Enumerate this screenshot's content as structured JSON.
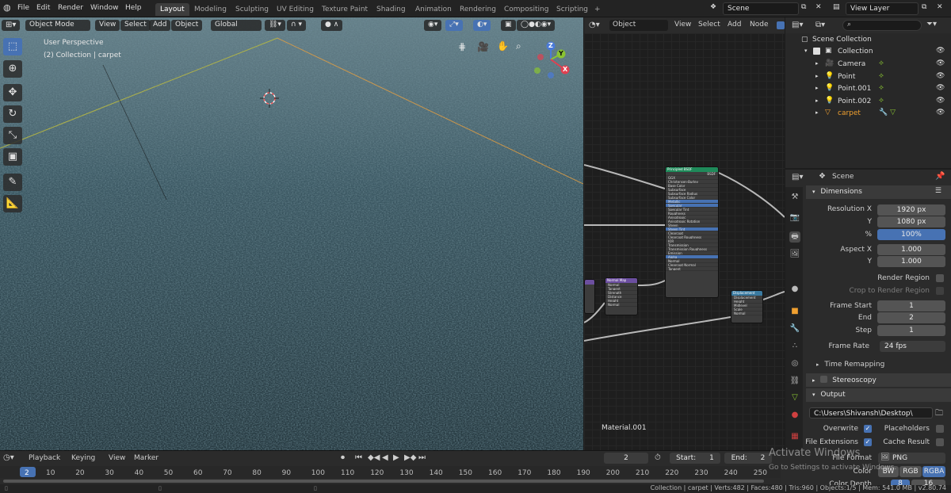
{
  "topbar": {
    "menus": [
      "File",
      "Edit",
      "Render",
      "Window",
      "Help"
    ],
    "workspaces": [
      "Layout",
      "Modeling",
      "Sculpting",
      "UV Editing",
      "Texture Paint",
      "Shading",
      "Animation",
      "Rendering",
      "Compositing",
      "Scripting"
    ],
    "add_workspace": "+",
    "scene_name": "Scene",
    "view_layer": "View Layer"
  },
  "viewport": {
    "mode": "Object Mode",
    "menus": [
      "View",
      "Select",
      "Add",
      "Object"
    ],
    "transform_orientation": "Global",
    "overlay_title": "User Perspective",
    "overlay_subtitle": "(2) Collection | carpet",
    "gizmo_axes": {
      "z": "Z",
      "y": "Y",
      "x": "X"
    }
  },
  "node_editor": {
    "header_object": "Object",
    "menus": [
      "View",
      "Select",
      "Add",
      "Node"
    ],
    "material_label": "Material.001",
    "bsdf_title": "Principled BSDF",
    "bsdf_output": "BSDF",
    "bsdf_inputs": [
      "GGX",
      "Christensen-Burley",
      "Base Color",
      "Subsurface",
      "Subsurface Radius",
      "Subsurface Color",
      "Metallic",
      "Specular",
      "Specular Tint",
      "Roughness",
      "Anisotropic",
      "Anisotropic Rotation",
      "Sheen",
      "Sheen Tint",
      "Clearcoat",
      "Clearcoat Roughness",
      "IOR",
      "Transmission",
      "Transmission Roughness",
      "Emission",
      "Alpha",
      "Normal",
      "Clearcoat Normal",
      "Tangent"
    ],
    "normal_title": "Normal Map",
    "normal_rows": [
      "Normal",
      "Tangent",
      "Strength",
      "Distance",
      "Height",
      "Normal"
    ],
    "disp_title": "Displacement",
    "disp_rows": [
      "Displacement",
      "Height",
      "Midlevel",
      "Scale",
      "Normal"
    ]
  },
  "outliner": {
    "root": "Scene Collection",
    "collection": "Collection",
    "items": [
      {
        "name": "Camera",
        "icon": "camera-icon"
      },
      {
        "name": "Point",
        "icon": "light-icon"
      },
      {
        "name": "Point.001",
        "icon": "light-icon"
      },
      {
        "name": "Point.002",
        "icon": "light-icon"
      },
      {
        "name": "carpet",
        "icon": "mesh-icon"
      }
    ],
    "search_placeholder": ""
  },
  "properties": {
    "context": "Scene",
    "dimensions_title": "Dimensions",
    "resolution_x_label": "Resolution X",
    "resolution_x": "1920 px",
    "resolution_y_label": "Y",
    "resolution_y": "1080 px",
    "percent_label": "%",
    "percent": "100%",
    "aspect_x_label": "Aspect X",
    "aspect_x": "1.000",
    "aspect_y_label": "Y",
    "aspect_y": "1.000",
    "render_region": "Render Region",
    "crop_region": "Crop to Render Region",
    "frame_start_label": "Frame Start",
    "frame_start": "1",
    "frame_end_label": "End",
    "frame_end": "2",
    "frame_step_label": "Step",
    "frame_step": "1",
    "frame_rate_label": "Frame Rate",
    "frame_rate": "24 fps",
    "time_remapping": "Time Remapping",
    "stereoscopy": "Stereoscopy",
    "output_title": "Output",
    "output_path": "C:\\Users\\Shivansh\\Desktop\\",
    "overwrite": "Overwrite",
    "placeholders": "Placeholders",
    "file_extensions": "File Extensions",
    "cache_result": "Cache Result",
    "file_format_label": "File Format",
    "file_format": "PNG",
    "color_label": "Color",
    "color_modes": [
      "BW",
      "RGB",
      "RGBA"
    ],
    "color_depth_label": "Color Depth",
    "color_depths": [
      "8",
      "16"
    ]
  },
  "timeline": {
    "playback": "Playback",
    "keying": "Keying",
    "view": "View",
    "marker": "Marker",
    "current_frame": "2",
    "start_label": "Start:",
    "start": "1",
    "end_label": "End:",
    "end": "2",
    "frame_ticks": [
      "2",
      "10",
      "20",
      "30",
      "40",
      "50",
      "60",
      "70",
      "80",
      "90",
      "100",
      "110",
      "120",
      "130",
      "140",
      "150",
      "160",
      "170",
      "180",
      "190",
      "200",
      "210",
      "220",
      "230",
      "240",
      "250"
    ]
  },
  "status_bar": "Collection | carpet | Verts:482 | Faces:480 | Tris:960 | Objects:1/5 | Mem: 541.0 MB | v2.80.74",
  "watermark": {
    "title": "Activate Windows",
    "subtitle": "Go to Settings to activate Windows."
  },
  "colors": {
    "accent": "#4772b3",
    "active_object": "#f0a030",
    "bsdf_header": "#1f8a5a",
    "vector_header": "#6c4fa0"
  }
}
